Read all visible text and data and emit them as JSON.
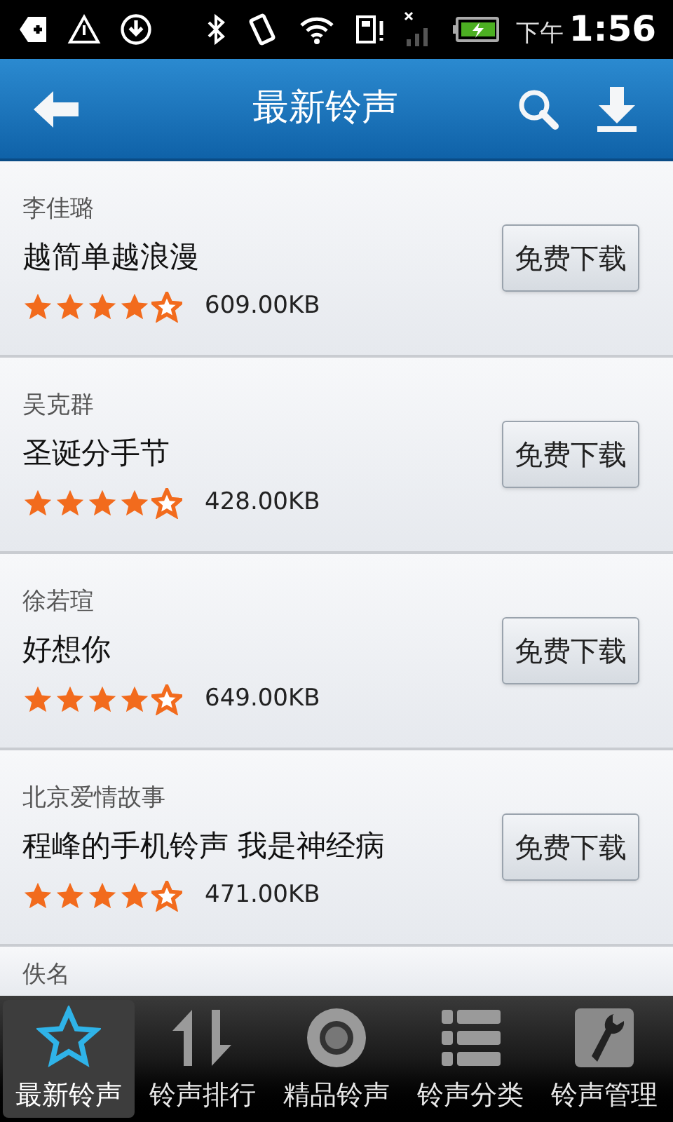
{
  "status_bar": {
    "am_pm": "下午",
    "time": "1:56"
  },
  "header": {
    "title": "最新铃声"
  },
  "ringtones": [
    {
      "artist": "李佳璐",
      "title": "越简单越浪漫",
      "stars": 4,
      "size": "609.00KB",
      "button": "免费下载"
    },
    {
      "artist": "吴克群",
      "title": "圣诞分手节",
      "stars": 4,
      "size": "428.00KB",
      "button": "免费下载"
    },
    {
      "artist": "徐若瑄",
      "title": "好想你",
      "stars": 4,
      "size": "649.00KB",
      "button": "免费下载"
    },
    {
      "artist": "北京爱情故事",
      "title": "程峰的手机铃声 我是神经病",
      "stars": 4,
      "size": "471.00KB",
      "button": "免费下载"
    },
    {
      "artist": "佚名"
    }
  ],
  "bottom_nav": [
    {
      "label": "最新铃声",
      "kind": "star",
      "selected": true
    },
    {
      "label": "铃声排行",
      "kind": "sort",
      "selected": false
    },
    {
      "label": "精品铃声",
      "kind": "disc",
      "selected": false
    },
    {
      "label": "铃声分类",
      "kind": "list",
      "selected": false
    },
    {
      "label": "铃声管理",
      "kind": "wrench",
      "selected": false
    }
  ]
}
